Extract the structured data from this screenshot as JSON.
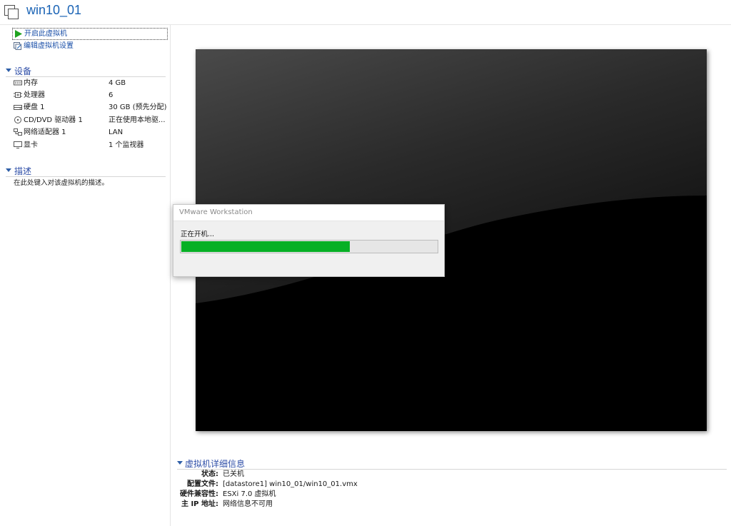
{
  "header": {
    "title": "win10_01",
    "icon": "vm-icon"
  },
  "actions": [
    {
      "label": "开启此虚拟机",
      "icon": "play-icon"
    },
    {
      "label": "编辑虚拟机设置",
      "icon": "edit-settings-icon"
    }
  ],
  "devices": {
    "title": "设备",
    "items": [
      {
        "name": "内存",
        "value": "4 GB",
        "icon": "memory-icon"
      },
      {
        "name": "处理器",
        "value": "6",
        "icon": "cpu-icon"
      },
      {
        "name": "硬盘 1",
        "value": "30 GB (预先分配)",
        "icon": "disk-icon"
      },
      {
        "name": "CD/DVD 驱动器 1",
        "value": "正在使用本地驱...",
        "icon": "cd-icon"
      },
      {
        "name": "网络适配器 1",
        "value": "LAN",
        "icon": "network-icon"
      },
      {
        "name": "显卡",
        "value": "1 个监视器",
        "icon": "display-icon"
      }
    ]
  },
  "description": {
    "title": "描述",
    "text": "在此处键入对该虚拟机的描述。"
  },
  "dialog": {
    "title": "VMware Workstation",
    "status": "正在开机...",
    "progress": 0.66,
    "progress_color": "#06b025"
  },
  "details": {
    "title": "虚拟机详细信息",
    "rows": [
      {
        "key": "状态:",
        "value": "已关机"
      },
      {
        "key": "配置文件:",
        "value": "[datastore1] win10_01/win10_01.vmx"
      },
      {
        "key": "硬件兼容性:",
        "value": "ESXi 7.0 虚拟机"
      },
      {
        "key": "主 IP 地址:",
        "value": "网络信息不可用"
      }
    ]
  },
  "colors": {
    "accent": "#1a63b5",
    "section": "#2f4fa8"
  }
}
